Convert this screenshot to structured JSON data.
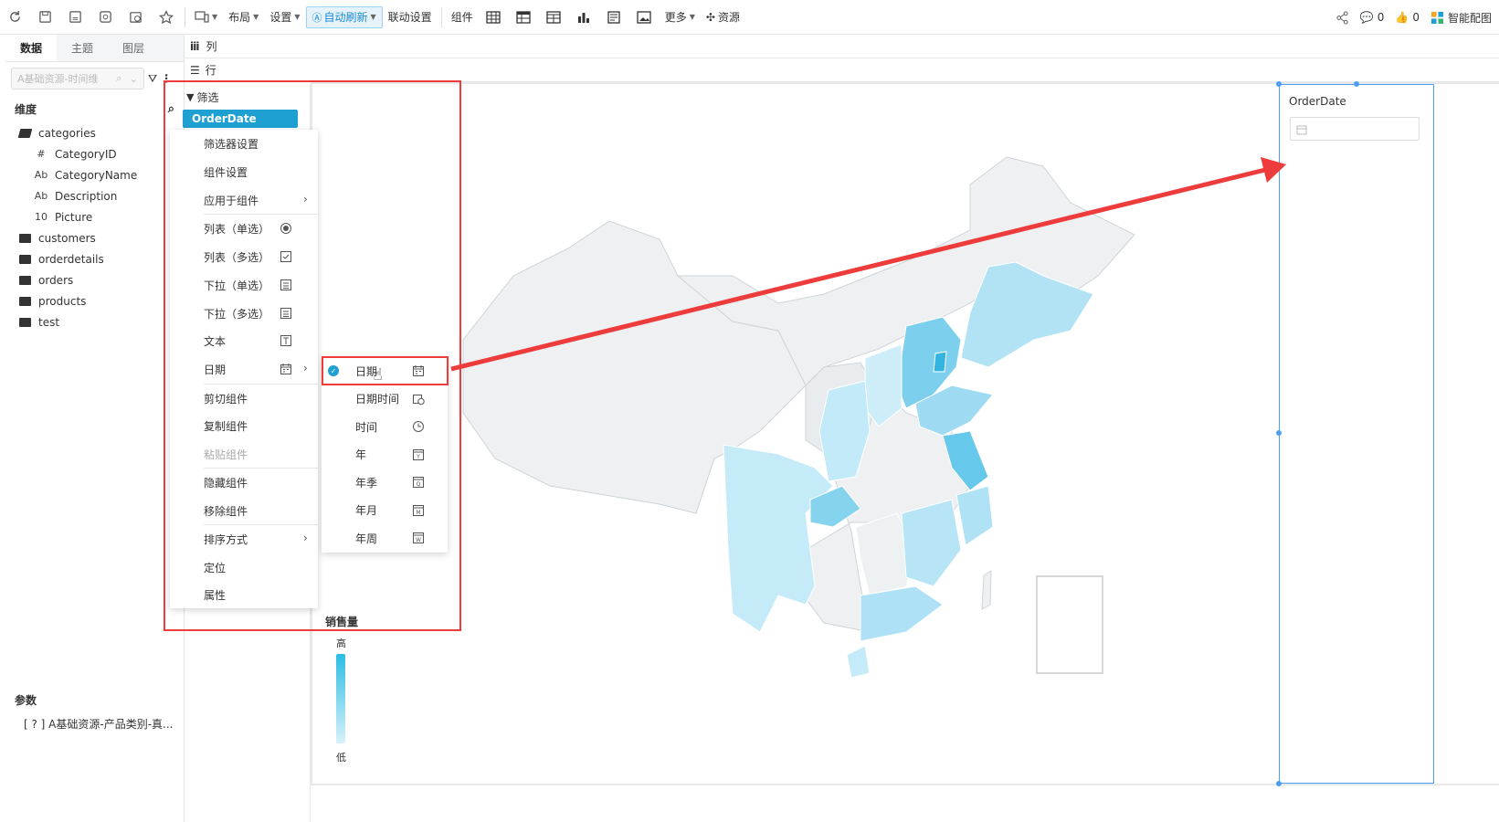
{
  "toolbar": {
    "layout": "布局",
    "settings": "设置",
    "auto_refresh": "自动刷新",
    "linkage": "联动设置",
    "component": "组件",
    "more": "更多",
    "resource": "资源",
    "comment_count": "0",
    "like_count": "0",
    "smart_chart": "智能配图"
  },
  "left_tabs": [
    "数据",
    "主题",
    "图层"
  ],
  "data_source_placeholder": "A基础资源-时间维",
  "dimension_title": "维度",
  "tree": [
    {
      "label": "categories",
      "type": "folder-open",
      "icon": "folder-open-icon"
    },
    {
      "label": "CategoryID",
      "type": "num",
      "glyph": "#",
      "icon": "number-icon"
    },
    {
      "label": "CategoryName",
      "type": "text",
      "glyph": "Ab",
      "icon": "text-field-icon"
    },
    {
      "label": "Description",
      "type": "text",
      "glyph": "Ab",
      "icon": "text-field-icon"
    },
    {
      "label": "Picture",
      "type": "bin",
      "glyph": "10",
      "icon": "binary-field-icon"
    },
    {
      "label": "customers",
      "type": "folder",
      "icon": "folder-icon"
    },
    {
      "label": "orderdetails",
      "type": "folder",
      "icon": "folder-icon"
    },
    {
      "label": "orders",
      "type": "folder",
      "icon": "folder-icon"
    },
    {
      "label": "products",
      "type": "folder",
      "icon": "folder-icon"
    },
    {
      "label": "test",
      "type": "folder",
      "icon": "folder-icon"
    }
  ],
  "params_title": "参数",
  "param_item": "[ ? ] A基础资源-产品类别-真...",
  "shelf": {
    "columns": "列",
    "rows": "行"
  },
  "filter": {
    "title": "筛选",
    "pill": "OrderDate"
  },
  "context_menu": [
    {
      "label": "筛选器设置"
    },
    {
      "label": "组件设置"
    },
    {
      "label": "应用于组件",
      "arrow": true
    },
    {
      "label": "列表（单选）",
      "icon": "radio-icon"
    },
    {
      "label": "列表（多选）",
      "icon": "checkbox-icon"
    },
    {
      "label": "下拉（单选）",
      "icon": "dropdown-single-icon"
    },
    {
      "label": "下拉（多选）",
      "icon": "dropdown-multi-icon"
    },
    {
      "label": "文本",
      "icon": "text-box-icon"
    },
    {
      "label": "日期",
      "icon": "calendar-icon",
      "arrow": true
    },
    {
      "label": "剪切组件"
    },
    {
      "label": "复制组件"
    },
    {
      "label": "粘贴组件",
      "disabled": true
    },
    {
      "label": "隐藏组件"
    },
    {
      "label": "移除组件"
    },
    {
      "label": "排序方式",
      "arrow": true
    },
    {
      "label": "定位"
    },
    {
      "label": "属性"
    }
  ],
  "date_submenu": [
    {
      "label": "日期",
      "icon": "calendar-icon",
      "checked": true
    },
    {
      "label": "日期时间",
      "icon": "datetime-icon"
    },
    {
      "label": "时间",
      "icon": "clock-icon"
    },
    {
      "label": "年",
      "icon": "year-icon",
      "badge": "Y"
    },
    {
      "label": "年季",
      "icon": "quarter-icon",
      "badge": "Q"
    },
    {
      "label": "年月",
      "icon": "month-icon",
      "badge": "M"
    },
    {
      "label": "年周",
      "icon": "week-icon",
      "badge": "W"
    }
  ],
  "map_legend": {
    "title": "销售量",
    "high": "高",
    "low": "低"
  },
  "right_component": {
    "label": "OrderDate"
  },
  "colors": {
    "accent": "#1ea0d2",
    "annotation_red": "#ee3b3b",
    "selection_blue": "#4f9ef5"
  }
}
